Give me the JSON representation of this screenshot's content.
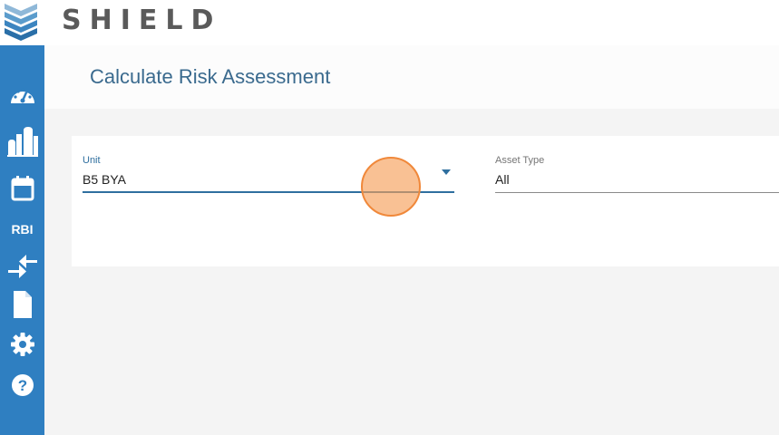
{
  "app": {
    "brand": "SHIELD"
  },
  "sidebar": {
    "items": [
      {
        "name": "dashboard",
        "icon": "speedometer-icon"
      },
      {
        "name": "assets",
        "icon": "factory-icon"
      },
      {
        "name": "calendar",
        "icon": "calendar-icon"
      },
      {
        "name": "rbi",
        "label": "RBI"
      },
      {
        "name": "transfer",
        "icon": "compare-arrows-icon"
      },
      {
        "name": "documents",
        "icon": "document-icon"
      },
      {
        "name": "settings",
        "icon": "gear-icon"
      },
      {
        "name": "help",
        "icon": "help-icon"
      }
    ]
  },
  "page": {
    "title": "Calculate Risk Assessment"
  },
  "form": {
    "unit": {
      "label": "Unit",
      "value": "B5 BYA"
    },
    "asset_type": {
      "label": "Asset Type",
      "value": "All"
    }
  },
  "colors": {
    "sidebar": "#2f7fc1",
    "accent": "#2f6f9f",
    "brand_text": "#5a5a5a",
    "cursor": "#f6a05a"
  }
}
